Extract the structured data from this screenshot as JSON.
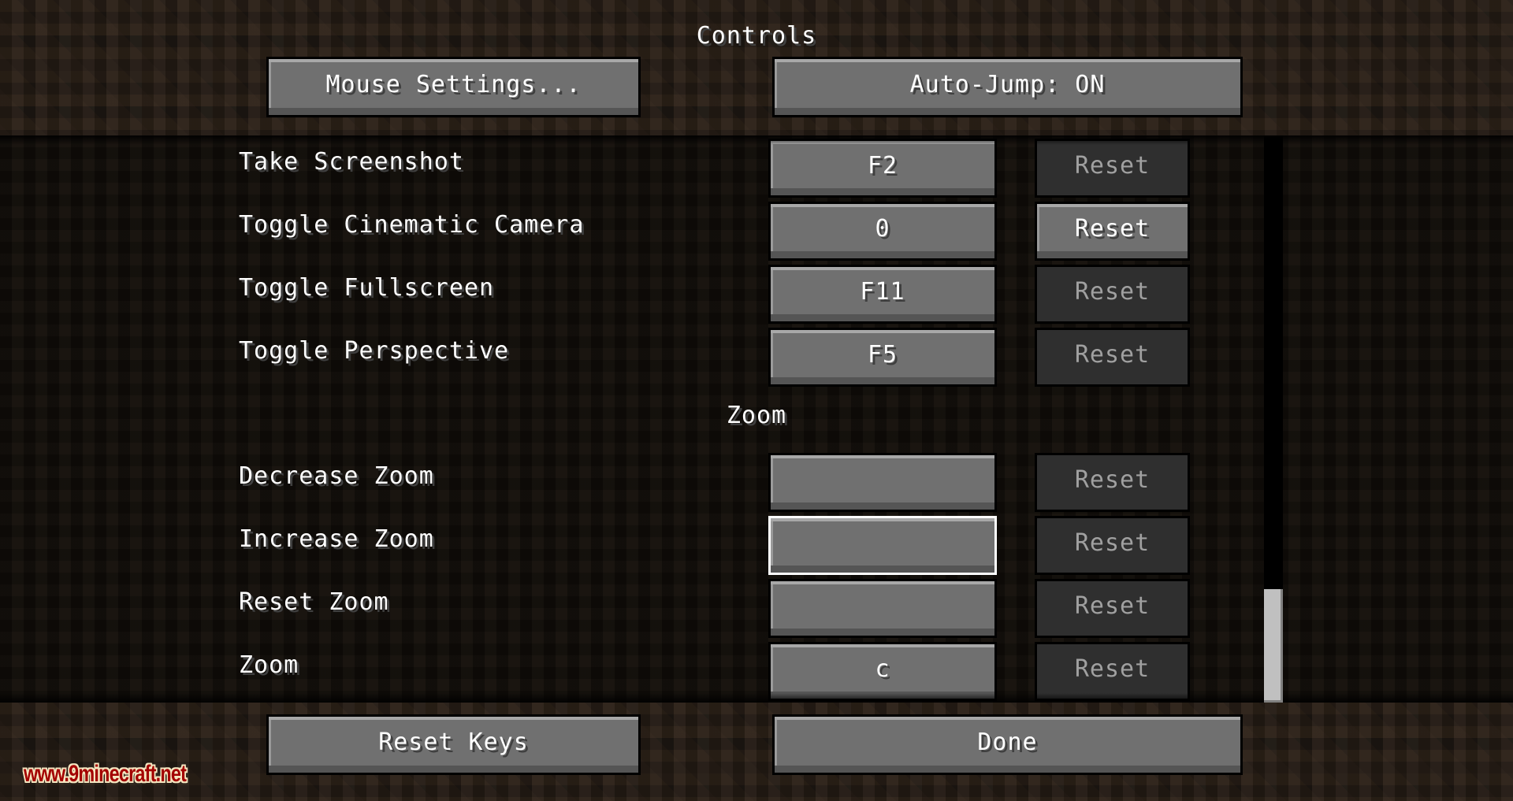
{
  "screen": {
    "title": "Controls"
  },
  "header_buttons": {
    "mouse_settings": "Mouse Settings...",
    "auto_jump": "Auto-Jump: ON"
  },
  "keybinds": {
    "rows": [
      {
        "label": "Take Screenshot",
        "key": "F2",
        "reset_label": "Reset",
        "reset_enabled": false,
        "selected": false
      },
      {
        "label": "Toggle Cinematic Camera",
        "key": "0",
        "reset_label": "Reset",
        "reset_enabled": true,
        "selected": false
      },
      {
        "label": "Toggle Fullscreen",
        "key": "F11",
        "reset_label": "Reset",
        "reset_enabled": false,
        "selected": false
      },
      {
        "label": "Toggle Perspective",
        "key": "F5",
        "reset_label": "Reset",
        "reset_enabled": false,
        "selected": false
      }
    ],
    "sections": [
      {
        "title": "Zoom",
        "rows": [
          {
            "label": "Decrease Zoom",
            "key": "",
            "reset_label": "Reset",
            "reset_enabled": false,
            "selected": false
          },
          {
            "label": "Increase Zoom",
            "key": "",
            "reset_label": "Reset",
            "reset_enabled": false,
            "selected": true
          },
          {
            "label": "Reset Zoom",
            "key": "",
            "reset_label": "Reset",
            "reset_enabled": false,
            "selected": false
          },
          {
            "label": "Zoom",
            "key": "c",
            "reset_label": "Reset",
            "reset_enabled": false,
            "selected": false
          }
        ]
      }
    ]
  },
  "scrollbar": {
    "position_fraction": 1.0
  },
  "footer_buttons": {
    "reset_keys": "Reset Keys",
    "done": "Done"
  },
  "watermark": "www.9minecraft.net",
  "colors": {
    "button_face": "#707070",
    "button_disabled_face": "#2f2f2f",
    "text": "#ffffff",
    "text_disabled": "#a0a0a0",
    "selected_border": "#ffffff",
    "watermark": "#a30000"
  }
}
